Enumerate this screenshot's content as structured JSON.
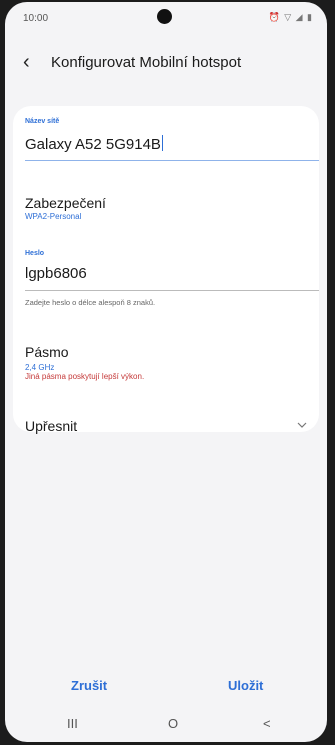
{
  "status_bar": {
    "time": "10:00",
    "indicators": "⏰ ▽ ◢ ▮"
  },
  "header": {
    "back_icon": "back-chevron-icon",
    "title": "Konfigurovat Mobilní hotspot"
  },
  "form": {
    "network_name": {
      "label": "Název sítě",
      "value": "Galaxy A52 5G914B"
    },
    "security": {
      "title": "Zabezpečení",
      "value": "WPA2-Personal"
    },
    "password": {
      "label": "Heslo",
      "value": "lgpb6806",
      "hint": "Zadejte heslo o délce alespoň 8 znaků."
    },
    "band": {
      "title": "Pásmo",
      "value": "2,4 GHz",
      "warning": "Jiná pásma poskytují lepší výkon."
    },
    "advanced": {
      "title": "Upřesnit",
      "icon": "chevron-down-icon"
    }
  },
  "buttons": {
    "cancel": "Zrušit",
    "save": "Uložit"
  },
  "navbar": {
    "recents": "III",
    "home": "O",
    "back": "<"
  },
  "colors": {
    "accent": "#2e6fd6",
    "warning": "#c53a3a",
    "background": "#f4f4f6",
    "card": "#ffffff"
  }
}
